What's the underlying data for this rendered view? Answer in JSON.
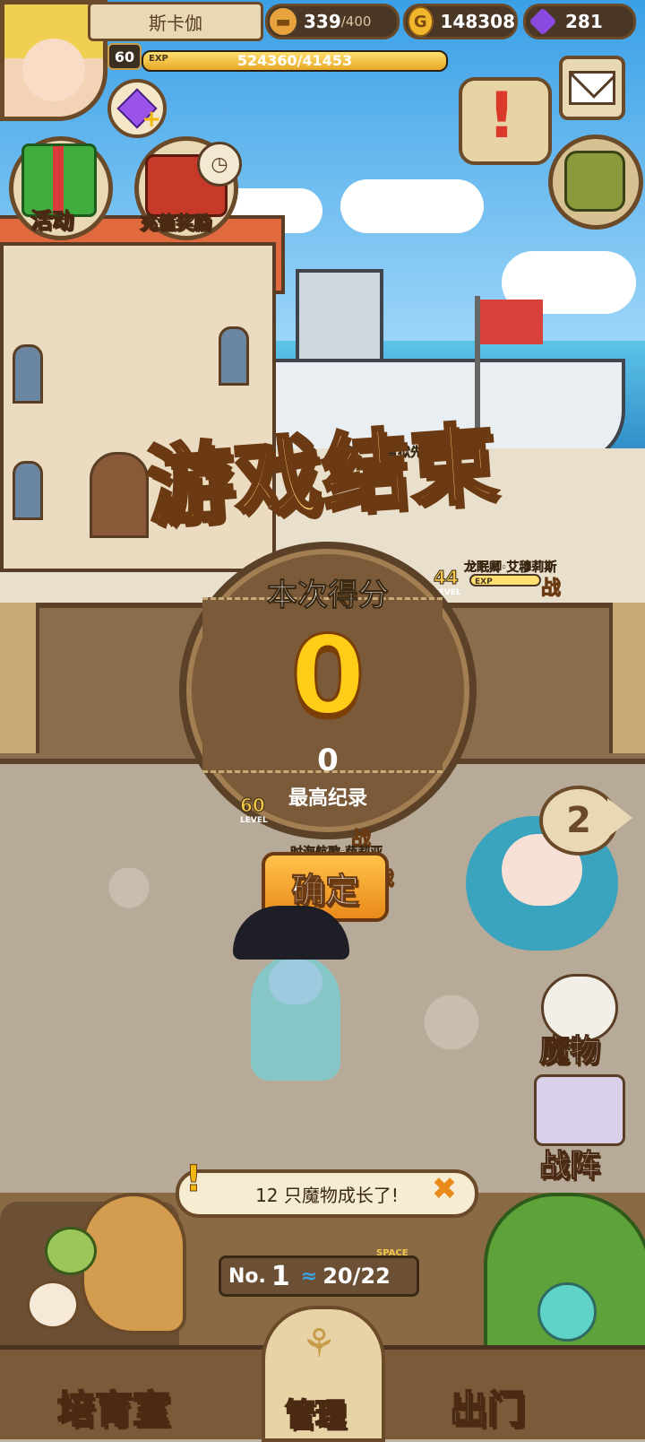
{
  "player": {
    "name": "斯卡伽",
    "level": "60",
    "exp_tag": "EXP",
    "exp_text": "524360/41453",
    "exp_progress": 1.0
  },
  "resources": {
    "stamina": "339",
    "stamina_max": "/400",
    "gold": "148308",
    "gold_symbol": "G",
    "gems": "281"
  },
  "buttons": {
    "event": "活动",
    "recharge": "充值奖励",
    "confirm": "确定",
    "monster": "魔物",
    "formation": "战阵",
    "page_number": "2",
    "nursery": "培育室",
    "manage": "管理",
    "go_out": "出门"
  },
  "game_over": {
    "title": "游戏结束",
    "score_label": "本次得分",
    "score": "0",
    "best_score": "0",
    "best_label": "最高纪录"
  },
  "characters": [
    {
      "name": "雪狱先锋·沃尔特"
    },
    {
      "name": "龙眠卿·艾穆莉斯",
      "level": "44",
      "level_tag": "LEVEL",
      "exp_tag": "EXP",
      "action": "战"
    },
    {
      "name": "时海航歌·萨莉亚",
      "level": "60",
      "level_tag": "LEVEL",
      "action": "战"
    }
  ],
  "notification": {
    "text": "12 只魔物成长了!"
  },
  "counter": {
    "no_label": "No.",
    "no_value": "1",
    "space_label": "SPACE",
    "space_value": "20/22"
  },
  "colors": {
    "frame_brown": "#6b4a2a",
    "gold": "#ffcc18",
    "banner": "#8a6d4c",
    "confirm_orange": "#e98a1a"
  }
}
